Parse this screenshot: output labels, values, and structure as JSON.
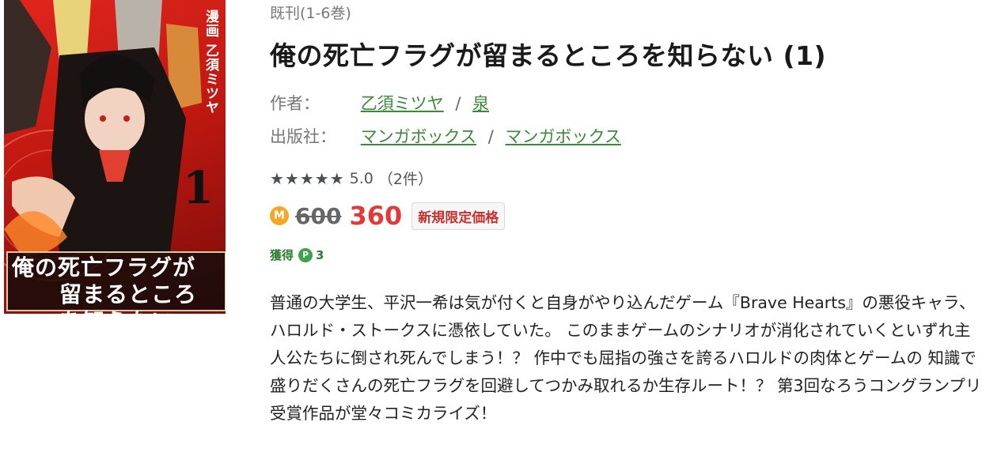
{
  "cover": {
    "author_text": "漫画 乙須ミツヤ",
    "volume_text": "1",
    "title_line1": "俺の死亡フラグが",
    "title_line2": "留まるところを知らない"
  },
  "product": {
    "series_tag": "既刊(1-6巻)",
    "title": "俺の死亡フラグが留まるところを知らない (1)",
    "author_label": "作者：",
    "authors": [
      "乙須ミツヤ",
      "泉"
    ],
    "publisher_label": "出版社：",
    "publishers": [
      "マンガボックス",
      "マンガボックス"
    ],
    "separator": "/"
  },
  "rating": {
    "stars": "★★★★★",
    "score": "5.0",
    "count": "（2件）"
  },
  "price": {
    "coin_icon_label": "M",
    "original": "600",
    "sale": "360",
    "badge": "新規限定価格"
  },
  "points": {
    "label": "獲得",
    "icon_label": "P",
    "value": "3"
  },
  "description": "普通の大学生、平沢一希は気が付くと自身がやり込んだゲーム『Brave Hearts』の悪役キャラ、ハロルド・ストークスに憑依していた。 このままゲームのシナリオが消化されていくといずれ主人公たちに倒され死んでしまう！？ 作中でも屈指の強さを誇るハロルドの肉体とゲームの 知識で盛りだくさんの死亡フラグを回避してつかみ取れるか生存ルート！？ 第3回なろうコングランプリ受賞作品が堂々コミカライズ！",
  "colors": {
    "link": "#3a8a3a",
    "sale_price": "#e03a3a",
    "coin": "#f5a623",
    "points": "#3da34a"
  }
}
